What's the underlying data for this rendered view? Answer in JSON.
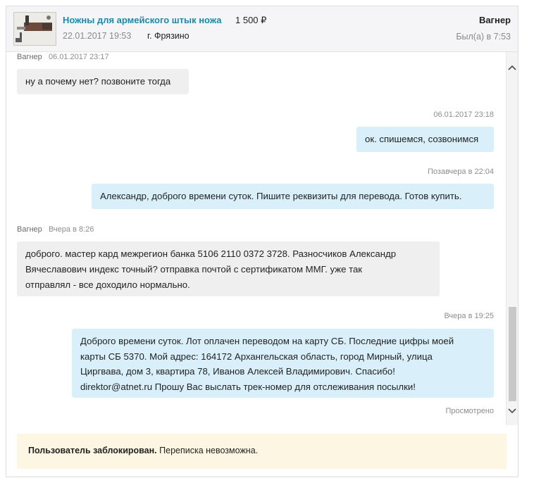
{
  "header": {
    "item_title": "Ножны для армейского штык ножа",
    "item_price": "1 500 ₽",
    "item_date": "22.01.2017 19:53",
    "item_city": "г. Фрязино",
    "peer_name": "Вагнер",
    "peer_seen": "Был(а) в 7:53"
  },
  "messages": [
    {
      "direction": "in",
      "author": "Вагнер",
      "time": "06.01.2017 23:17",
      "text": "ну а почему нет? позвоните тогда"
    },
    {
      "direction": "out",
      "author": "",
      "time": "06.01.2017 23:18",
      "text": "ок. спишемся, созвонимся"
    },
    {
      "direction": "out",
      "author": "",
      "time": "Позавчера в 22:04",
      "text": "Александр, доброго времени суток. Пишите реквизиты для перевода. Готов купить."
    },
    {
      "direction": "in",
      "author": "Вагнер",
      "time": "Вчера в 8:26",
      "lines": [
        "доброго. мастер кард межрегион банка 5106  2110  0372  3728. Разносчиков Александр",
        "Вячеславович индекс точный? отправка почтой с сертификатом ММГ. уже так",
        "отправлял - все доходило нормально."
      ]
    },
    {
      "direction": "out",
      "author": "",
      "time": "Вчера в 19:25",
      "lines": [
        "Доброго времени суток. Лот оплачен переводом на карту СБ. Последние цифры моей",
        "карты СБ 5370. Мой адрес: 164172 Архангельская область, город Мирный, улица",
        "Циргвава, дом 3, квартира 78, Иванов Алексей Владимирович. Спасибо!",
        "direktor@atnet.ru Прошу Вас выслать трек-номер для отслеживания посылки!"
      ]
    }
  ],
  "read_status": "Просмотрено",
  "blocked": {
    "bold": "Пользователь заблокирован.",
    "text": " Переписка невозможна."
  },
  "icons": {
    "scroll_up": "chevron-up-icon",
    "scroll_down": "chevron-down-icon"
  },
  "colors": {
    "incoming_bubble": "#efefef",
    "outgoing_bubble": "#d9f0fb",
    "link": "#1f87a8",
    "notice_bg": "#fdf6e3"
  }
}
